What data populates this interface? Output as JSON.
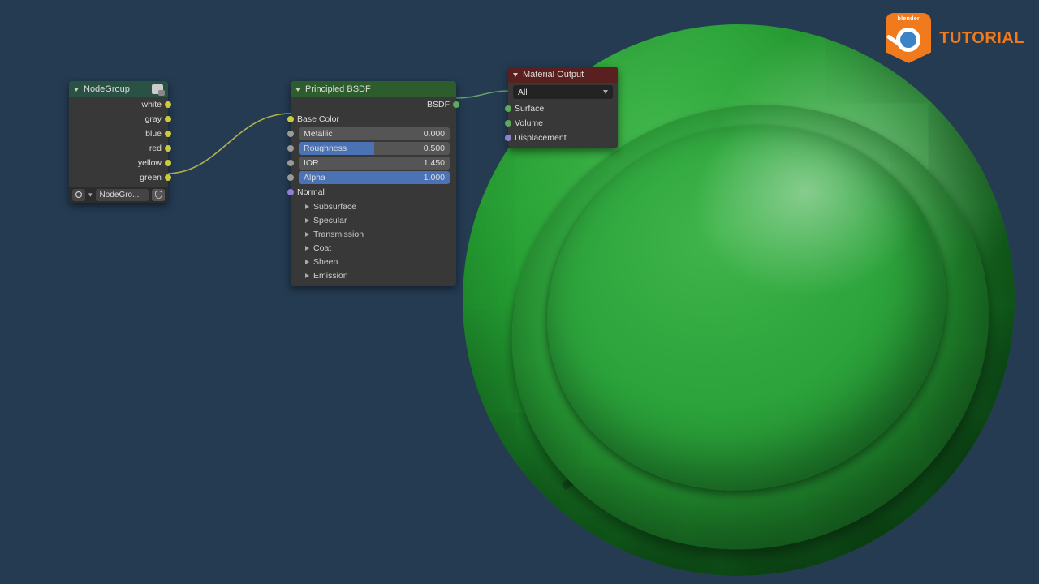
{
  "badge": {
    "brand": "blender",
    "label": "TUTORIAL"
  },
  "nodegroup": {
    "title": "NodeGroup",
    "outputs": [
      "white",
      "gray",
      "blue",
      "red",
      "yellow",
      "green"
    ],
    "picker_label": "NodeGro..."
  },
  "bsdf": {
    "title": "Principled BSDF",
    "out_label": "BSDF",
    "base_color_label": "Base Color",
    "metallic": {
      "label": "Metallic",
      "value": "0.000",
      "fill": "0%"
    },
    "roughness": {
      "label": "Roughness",
      "value": "0.500",
      "fill": "50%"
    },
    "ior": {
      "label": "IOR",
      "value": "1.450",
      "fill": "0%"
    },
    "alpha": {
      "label": "Alpha",
      "value": "1.000",
      "fill": "100%"
    },
    "normal_label": "Normal",
    "sections": [
      "Subsurface",
      "Specular",
      "Transmission",
      "Coat",
      "Sheen",
      "Emission"
    ]
  },
  "matout": {
    "title": "Material Output",
    "target": "All",
    "inputs": {
      "surface": "Surface",
      "volume": "Volume",
      "displacement": "Displacement"
    }
  }
}
